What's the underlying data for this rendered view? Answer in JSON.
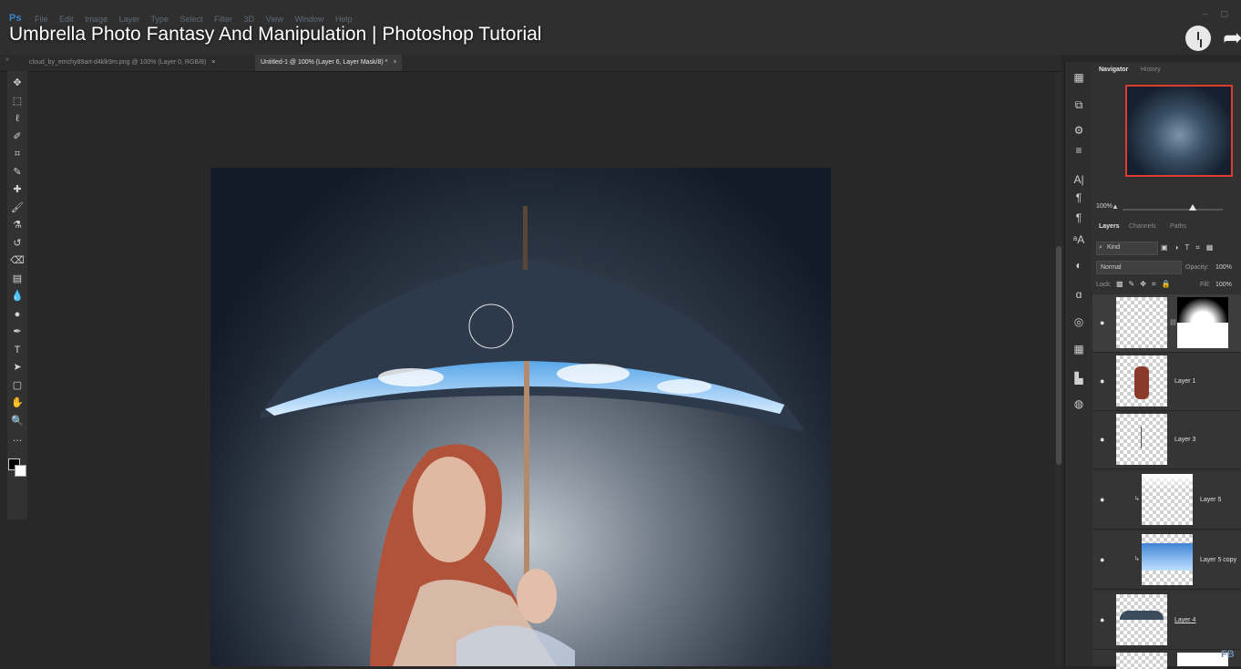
{
  "app": {
    "logo": "Ps",
    "menu": [
      "File",
      "Edit",
      "Image",
      "Layer",
      "Type",
      "Select",
      "Filter",
      "3D",
      "View",
      "Window",
      "Help"
    ],
    "video_title": "Umbrella Photo Fantasy And Manipulation | Photoshop Tutorial"
  },
  "tabs": [
    {
      "label": "cloud_by_emchy89art-d4klk9m.png @ 100% (Layer 0, RGB/8)",
      "close": "×"
    },
    {
      "label": "Untitled-1 @ 100% (Layer 6, Layer Mask/8) *",
      "close": "×"
    }
  ],
  "tools": [
    "move-tool",
    "marquee-tool",
    "lasso-tool",
    "quick-select-tool",
    "crop-tool",
    "eyedropper-tool",
    "healing-tool",
    "brush-tool",
    "stamp-tool",
    "history-brush-tool",
    "eraser-tool",
    "gradient-tool",
    "blur-tool",
    "dodge-tool",
    "pen-tool",
    "type-tool",
    "path-select-tool",
    "shape-tool",
    "hand-tool",
    "zoom-tool",
    "more-tools"
  ],
  "tool_glyphs": [
    "✥",
    "⬚",
    "ℓ",
    "✐",
    "⌗",
    "✎",
    "✚",
    "🖌",
    "⚗",
    "↺",
    "⌫",
    "▤",
    "💧",
    "●",
    "✒",
    "T",
    "➤",
    "▢",
    "✋",
    "🔍",
    "…"
  ],
  "navigator": {
    "tabs": [
      "Navigator",
      "History"
    ],
    "zoom": "100%"
  },
  "layers_panel": {
    "tabs": [
      "Layers",
      "Channels",
      "Paths"
    ],
    "filter_label": "Kind",
    "blend_mode": "Normal",
    "opacity_label": "Opacity:",
    "opacity_value": "100%",
    "lock_label": "Lock:",
    "fill_label": "Fill:",
    "fill_value": "100%",
    "layers": [
      {
        "name": ""
      },
      {
        "name": "Layer 1"
      },
      {
        "name": "Layer 3"
      },
      {
        "name": "Layer 5"
      },
      {
        "name": "Layer 5 copy"
      },
      {
        "name": "Layer 4"
      }
    ]
  },
  "colors": {
    "accent": "#3b86c8",
    "nav_frame": "#e03b2e"
  }
}
